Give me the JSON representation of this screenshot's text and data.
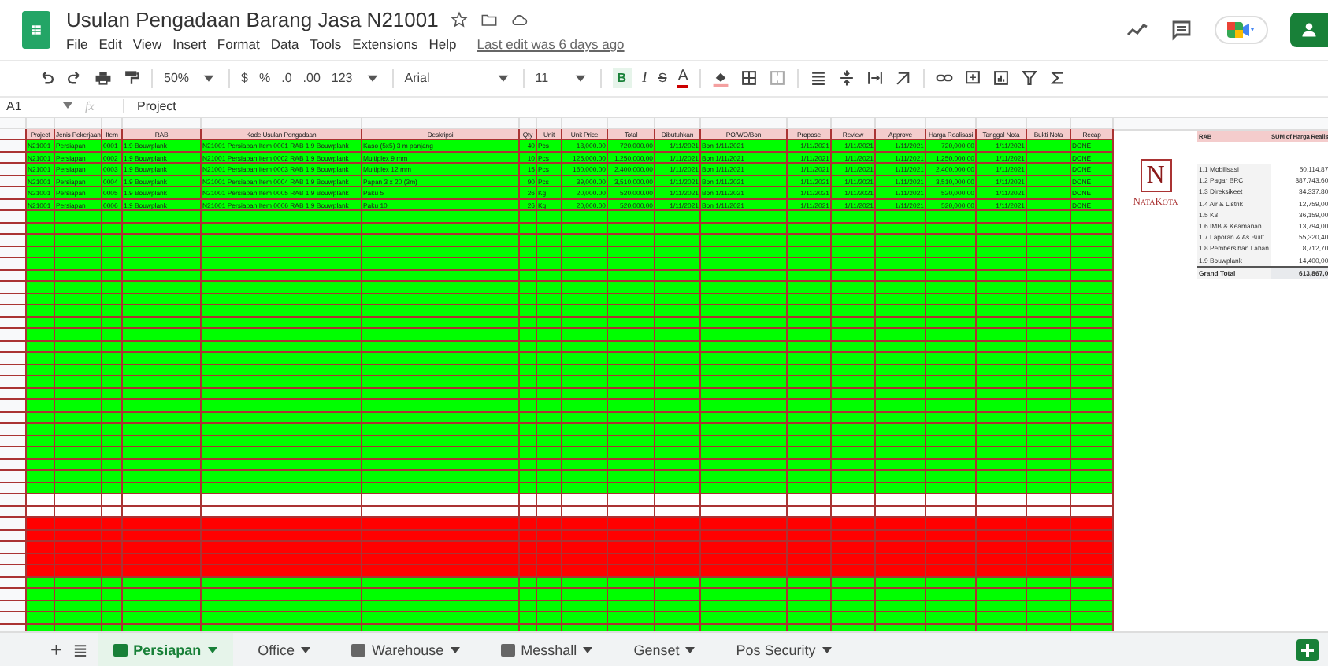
{
  "doc": {
    "title": "Usulan Pengadaan Barang Jasa N21001",
    "menu": [
      "File",
      "Edit",
      "View",
      "Insert",
      "Format",
      "Data",
      "Tools",
      "Extensions",
      "Help"
    ],
    "last_edit": "Last edit was 6 days ago"
  },
  "toolbar": {
    "zoom": "50%",
    "currency": "$",
    "percent": "%",
    "dec_less": ".0",
    "dec_more": ".00",
    "format": "123",
    "font": "Arial",
    "size": "11",
    "bold": "B",
    "italic": "I",
    "strike": "S",
    "text_color": "A"
  },
  "formula": {
    "cell": "A1",
    "fx": "fx",
    "value": "Project"
  },
  "table": {
    "columns": [
      "Project",
      "Jenis Pekerjaan",
      "Item",
      "RAB",
      "Kode Usulan Pengadaan",
      "Deskripsi",
      "Qty",
      "Unit",
      "Unit Price",
      "Total",
      "Dibutuhkan",
      "PO/WO/Bon",
      "Propose",
      "Review",
      "Approve",
      "Harga Realisasi",
      "Tanggal Nota",
      "Bukti Nota",
      "Recap"
    ],
    "rows": [
      {
        "color": "#00ff00",
        "cells": [
          "N21001",
          "Persiapan",
          "0001",
          "1.9 Bouwplank",
          "N21001 Persiapan Item 0001 RAB 1.9 Bouwplank",
          "Kaso (5x5) 3 m panjang",
          "40",
          "Pcs",
          "18,000.00",
          "720,000.00",
          "1/11/2021",
          "Bon 1/11/2021",
          "1/11/2021",
          "1/11/2021",
          "1/11/2021",
          "720,000.00",
          "1/11/2021",
          "",
          "DONE"
        ]
      },
      {
        "color": "#00ff00",
        "cells": [
          "N21001",
          "Persiapan",
          "0002",
          "1.9 Bouwplank",
          "N21001 Persiapan Item 0002 RAB 1.9 Bouwplank",
          "Multiplex 9 mm",
          "10",
          "Pcs",
          "125,000.00",
          "1,250,000.00",
          "1/11/2021",
          "Bon 1/11/2021",
          "1/11/2021",
          "1/11/2021",
          "1/11/2021",
          "1,250,000.00",
          "1/11/2021",
          "",
          "DONE"
        ]
      },
      {
        "color": "#00ff00",
        "cells": [
          "N21001",
          "Persiapan",
          "0003",
          "1.9 Bouwplank",
          "N21001 Persiapan Item 0003 RAB 1.9 Bouwplank",
          "Multiplex 12 mm",
          "15",
          "Pcs",
          "160,000.00",
          "2,400,000.00",
          "1/11/2021",
          "Bon 1/11/2021",
          "1/11/2021",
          "1/11/2021",
          "1/11/2021",
          "2,400,000.00",
          "1/11/2021",
          "",
          "DONE"
        ]
      },
      {
        "color": "#00ff00",
        "cells": [
          "N21001",
          "Persiapan",
          "0004",
          "1.9 Bouwplank",
          "N21001 Persiapan Item 0004 RAB 1.9 Bouwplank",
          "Papan 3 x 20 (3m)",
          "90",
          "Pcs",
          "39,000.00",
          "3,510,000.00",
          "1/11/2021",
          "Bon 1/11/2021",
          "1/11/2021",
          "1/11/2021",
          "1/11/2021",
          "3,510,000.00",
          "1/11/2021",
          "",
          "DONE"
        ]
      },
      {
        "color": "#00ff00",
        "cells": [
          "N21001",
          "Persiapan",
          "0005",
          "1.9 Bouwplank",
          "N21001 Persiapan Item 0005 RAB 1.9 Bouwplank",
          "Paku 5",
          "26",
          "Kg",
          "20,000.00",
          "520,000.00",
          "1/11/2021",
          "Bon 1/11/2021",
          "1/11/2021",
          "1/11/2021",
          "1/11/2021",
          "520,000.00",
          "1/11/2021",
          "",
          "DONE"
        ]
      },
      {
        "color": "#00ff00",
        "cells": [
          "N21001",
          "Persiapan",
          "0006",
          "1.9 Bouwplank",
          "N21001 Persiapan Item 0006 RAB 1.9 Bouwplank",
          "Paku 10",
          "26",
          "Kg",
          "20,000.00",
          "520,000.00",
          "1/11/2021",
          "Bon 1/11/2021",
          "1/11/2021",
          "1/11/2021",
          "1/11/2021",
          "520,000.00",
          "1/11/2021",
          "",
          "DONE"
        ]
      },
      {
        "color": "#00ff00"
      },
      {
        "color": "#00ff00"
      },
      {
        "color": "#00ff00"
      },
      {
        "color": "#00ff00"
      },
      {
        "color": "#00ff00"
      },
      {
        "color": "#00ff00"
      },
      {
        "color": "#00ff00"
      },
      {
        "color": "#00ff00"
      },
      {
        "color": "#00ff00"
      },
      {
        "color": "#00ff00"
      },
      {
        "color": "#00ff00"
      },
      {
        "color": "#00ff00"
      },
      {
        "color": "#00ff00"
      },
      {
        "color": "#00ff00"
      },
      {
        "color": "#00ff00"
      },
      {
        "color": "#00ff00"
      },
      {
        "color": "#00ff00"
      },
      {
        "color": "#00ff00"
      },
      {
        "color": "#00ff00"
      },
      {
        "color": "#00ff00"
      },
      {
        "color": "#00ff00"
      },
      {
        "color": "#00ff00"
      },
      {
        "color": "#00ff00"
      },
      {
        "color": "#00ff00"
      },
      {
        "color": "#ffffff"
      },
      {
        "color": "#ffffff"
      },
      {
        "color": "#ff0000"
      },
      {
        "color": "#ff0000"
      },
      {
        "color": "#ff0000"
      },
      {
        "color": "#ff0000"
      },
      {
        "color": "#ff0000"
      },
      {
        "color": "#00ff00"
      },
      {
        "color": "#00ff00"
      },
      {
        "color": "#00ff00"
      },
      {
        "color": "#00ff00"
      },
      {
        "color": "#00ff00"
      }
    ]
  },
  "logo": {
    "letter": "N",
    "name": "NataKota"
  },
  "pivot": {
    "columns": [
      "RAB",
      "SUM of Harga Realis"
    ],
    "rows": [
      [
        "1.1 Mobilisasi",
        "50,114,87"
      ],
      [
        "1.2 Pagar BRC",
        "387,743,60"
      ],
      [
        "1.3 Direksikeet",
        "34,337,80"
      ],
      [
        "1.4 Air & Listrik",
        "12,759,00"
      ],
      [
        "1.5 K3",
        "36,159,00"
      ],
      [
        "1.6 IMB & Keamanan",
        "13,794,00"
      ],
      [
        "1.7 Laporan & As Built",
        "55,320,40"
      ],
      [
        "1.8 Pembersihan Lahan",
        "8,712,70"
      ],
      [
        "1.9 Bouwplank",
        "14,400,00"
      ]
    ],
    "total": [
      "Grand Total",
      "613,867,0"
    ]
  },
  "sheets": {
    "add": "+",
    "tabs": [
      {
        "label": "Persiapan",
        "selected": true,
        "icon": true
      },
      {
        "label": "Office",
        "selected": false,
        "icon": false
      },
      {
        "label": "Warehouse",
        "selected": false,
        "icon": true
      },
      {
        "label": "Messhall",
        "selected": false,
        "icon": true
      },
      {
        "label": "Genset",
        "selected": false,
        "icon": false
      },
      {
        "label": "Pos Security",
        "selected": false,
        "icon": false
      }
    ]
  }
}
